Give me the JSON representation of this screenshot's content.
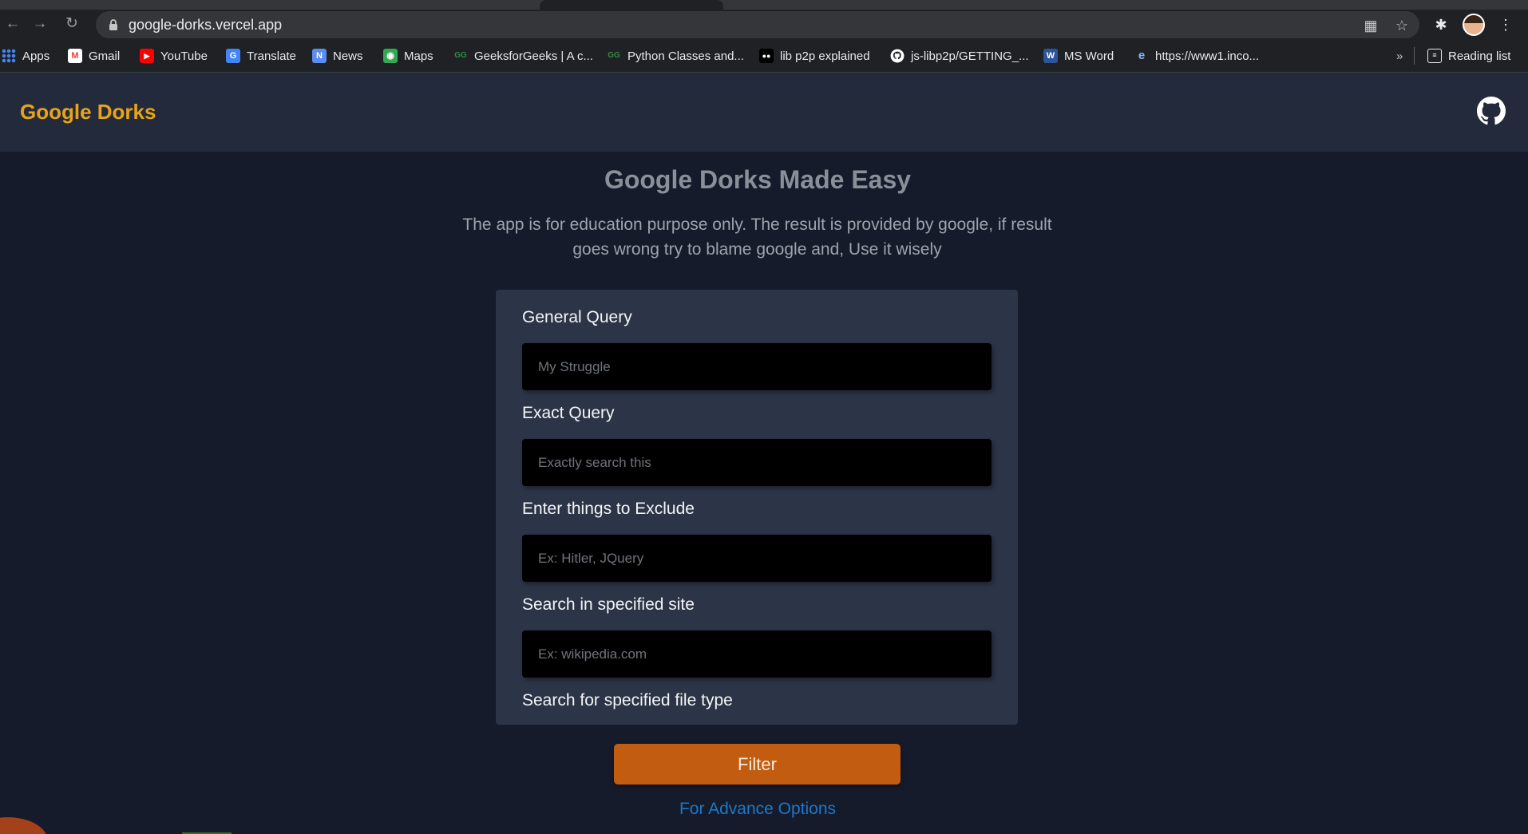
{
  "browser": {
    "url": "google-dorks.vercel.app",
    "bookmarks": [
      {
        "label": "Apps",
        "icon": "apps-grid-icon"
      },
      {
        "label": "Gmail",
        "icon": "gmail-icon"
      },
      {
        "label": "YouTube",
        "icon": "youtube-icon"
      },
      {
        "label": "Translate",
        "icon": "translate-icon"
      },
      {
        "label": "News",
        "icon": "news-icon"
      },
      {
        "label": "Maps",
        "icon": "maps-icon"
      },
      {
        "label": "GeeksforGeeks | A c...",
        "icon": "geeksforgeeks-icon"
      },
      {
        "label": "Python Classes and...",
        "icon": "geeksforgeeks-icon"
      },
      {
        "label": "lib p2p explained",
        "icon": "medium-icon"
      },
      {
        "label": "js-libp2p/GETTING_...",
        "icon": "github-icon"
      },
      {
        "label": "MS Word",
        "icon": "word-icon"
      },
      {
        "label": "https://www1.inco...",
        "icon": "ie-icon"
      }
    ],
    "more_label": "»",
    "reading_list": "Reading list"
  },
  "header": {
    "brand": "Google Dorks"
  },
  "hero": {
    "title": "Google Dorks Made Easy",
    "subtitle": "The app is for education purpose only. The result is provided by google, if result goes wrong try to blame google and, Use it wisely"
  },
  "form": {
    "general": {
      "label": "General Query",
      "placeholder": "My Struggle"
    },
    "exact": {
      "label": "Exact Query",
      "placeholder": "Exactly search this"
    },
    "exclude": {
      "label": "Enter things to Exclude",
      "placeholder": "Ex: Hitler, JQuery"
    },
    "site": {
      "label": "Search in specified site",
      "placeholder": "Ex: wikipedia.com"
    },
    "filetype": {
      "label": "Search for specified file type"
    }
  },
  "actions": {
    "filter": "Filter",
    "advance": "For Advance Options"
  },
  "colors": {
    "page_bg": "#151b2a",
    "header_bg": "#232a3b",
    "card_bg": "#2c3447",
    "brand": "#e8a417",
    "button": "#c15c10",
    "link": "#1d78c9"
  }
}
